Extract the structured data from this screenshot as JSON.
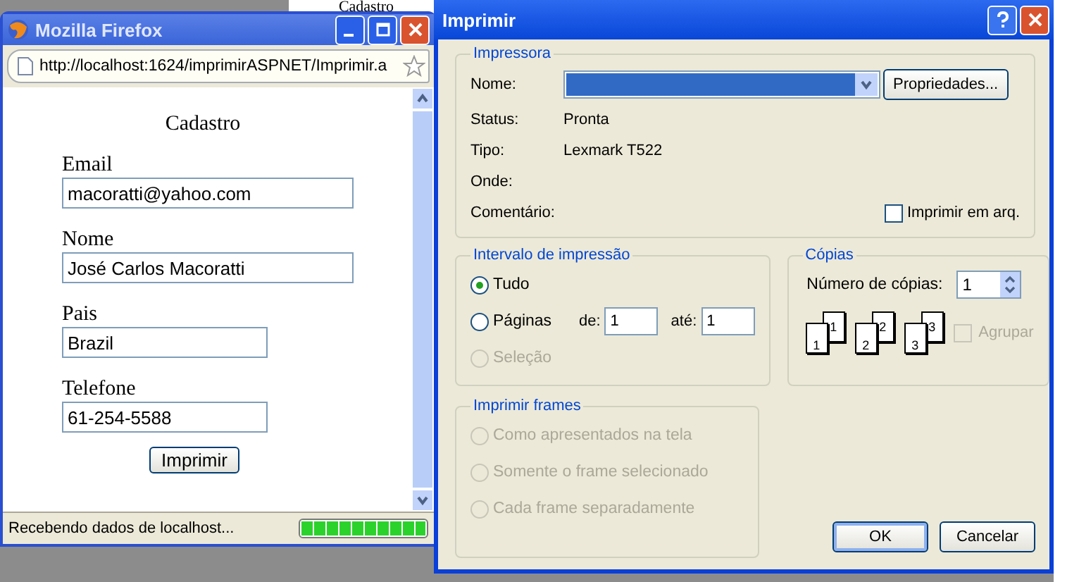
{
  "background_window": {
    "heading": "Cadastro"
  },
  "browser": {
    "title": "Mozilla Firefox",
    "url": "http://localhost:1624/imprimirASPNET/Imprimir.a",
    "page": {
      "heading": "Cadastro",
      "fields": [
        {
          "label": "Email",
          "value": "macoratti@yahoo.com",
          "kind": "long"
        },
        {
          "label": "Nome",
          "value": "José Carlos Macoratti",
          "kind": "long"
        },
        {
          "label": "Pais",
          "value": "Brazil",
          "kind": "short"
        },
        {
          "label": "Telefone",
          "value": "61-254-5588",
          "kind": "short"
        }
      ],
      "button": "Imprimir"
    },
    "status_text": "Recebendo dados de localhost...",
    "progress": {
      "level": 1
    }
  },
  "dialog": {
    "title": "Imprimir",
    "printer": {
      "legend": "Impressora",
      "name_label": "Nome:",
      "properties_button": "Propriedades...",
      "info": [
        {
          "label": "Status:",
          "value": "Pronta"
        },
        {
          "label": "Tipo:",
          "value": "Lexmark T522"
        },
        {
          "label": "Onde:"
        },
        {
          "label": "Comentário:"
        }
      ],
      "print_to_file": {
        "label": "Imprimir em arq.",
        "checked": false
      }
    },
    "range": {
      "legend": "Intervalo de impressão",
      "options": [
        {
          "label": "Tudo",
          "selected": true,
          "disabled": false
        },
        {
          "label": "Páginas",
          "selected": false,
          "disabled": false
        },
        {
          "label": "Seleção",
          "selected": false,
          "disabled": true
        }
      ],
      "from_label": "de:",
      "from_value": "1",
      "to_label": "até:",
      "to_value": "1"
    },
    "copies": {
      "legend": "Cópias",
      "count_label": "Número de cópias:",
      "count_value": "1",
      "page_stacks": [
        {
          "back": "1",
          "front": "1"
        },
        {
          "back": "2",
          "front": "2"
        },
        {
          "back": "3",
          "front": "3"
        }
      ],
      "collate": {
        "label": "Agrupar",
        "checked": false,
        "disabled": true
      }
    },
    "frames": {
      "legend": "Imprimir frames",
      "options": [
        {
          "label": "Como apresentados na tela",
          "selected": false,
          "disabled": true
        },
        {
          "label": "Somente o frame selecionado",
          "selected": false,
          "disabled": true
        },
        {
          "label": "Cada frame separadamente",
          "selected": false,
          "disabled": true
        }
      ]
    },
    "buttons": [
      {
        "label": "OK",
        "default": true
      },
      {
        "label": "Cancelar",
        "default": false
      }
    ]
  }
}
